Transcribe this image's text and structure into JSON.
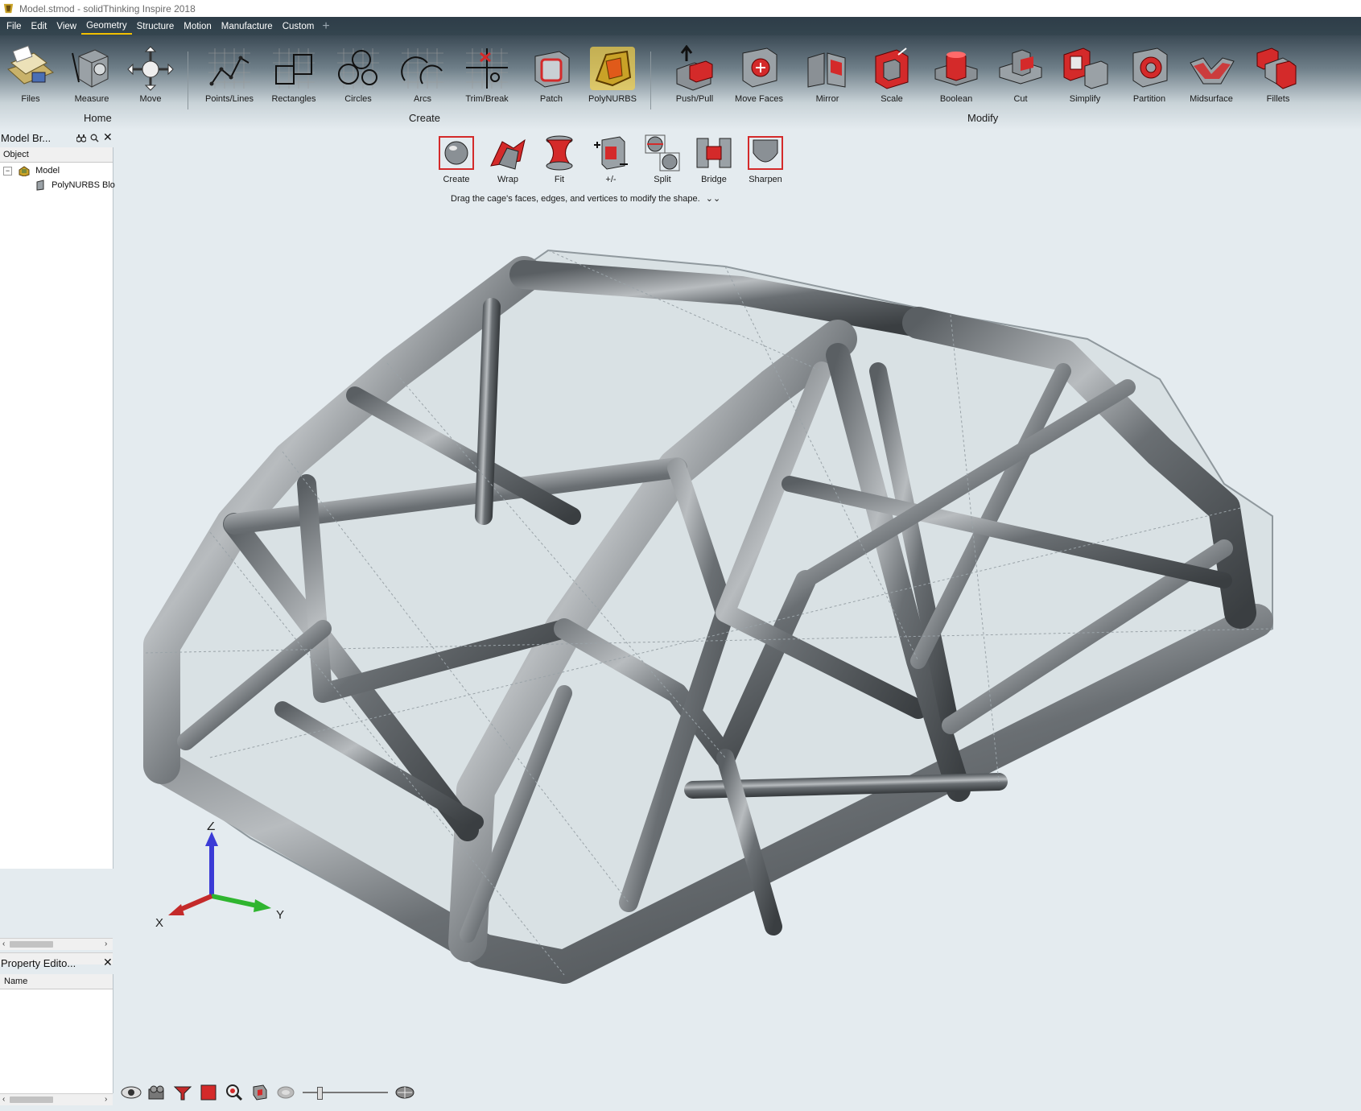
{
  "window": {
    "title": "Model.stmod - solidThinking Inspire 2018"
  },
  "menu": {
    "items": [
      "File",
      "Edit",
      "View",
      "Geometry",
      "Structure",
      "Motion",
      "Manufacture",
      "Custom"
    ],
    "active": "Geometry"
  },
  "ribbon": {
    "groups": {
      "home": "Home",
      "create": "Create",
      "modify": "Modify"
    },
    "home_tools": {
      "files": "Files",
      "measure": "Measure",
      "move": "Move"
    },
    "create_tools": {
      "points": "Points/Lines",
      "rectangles": "Rectangles",
      "circles": "Circles",
      "arcs": "Arcs",
      "trim": "Trim/Break",
      "patch": "Patch",
      "polynurbs": "PolyNURBS"
    },
    "modify_tools": {
      "pushpull": "Push/Pull",
      "movefaces": "Move Faces",
      "mirror": "Mirror",
      "scale": "Scale",
      "boolean": "Boolean",
      "cut": "Cut",
      "simplify": "Simplify",
      "partition": "Partition",
      "midsurface": "Midsurface",
      "fillets": "Fillets"
    }
  },
  "polynurbs_toolbar": {
    "tools": {
      "create": "Create",
      "wrap": "Wrap",
      "fit": "Fit",
      "plusminus": "+/-",
      "split": "Split",
      "bridge": "Bridge",
      "sharpen": "Sharpen"
    },
    "hint": "Drag the cage's faces, edges, and vertices to modify the shape."
  },
  "model_browser": {
    "title": "Model Br...",
    "column": "Object",
    "root": "Model",
    "child": "PolyNURBS Blo"
  },
  "property_editor": {
    "title": "Property Edito...",
    "column": "Name"
  },
  "triad": {
    "z": "Z",
    "y": "Y",
    "x": "X"
  },
  "colors": {
    "accent": "#f3c000",
    "menubar": "#2e3d48",
    "viewport_bg": "#e4ebef",
    "tool_red": "#d42a2a"
  }
}
